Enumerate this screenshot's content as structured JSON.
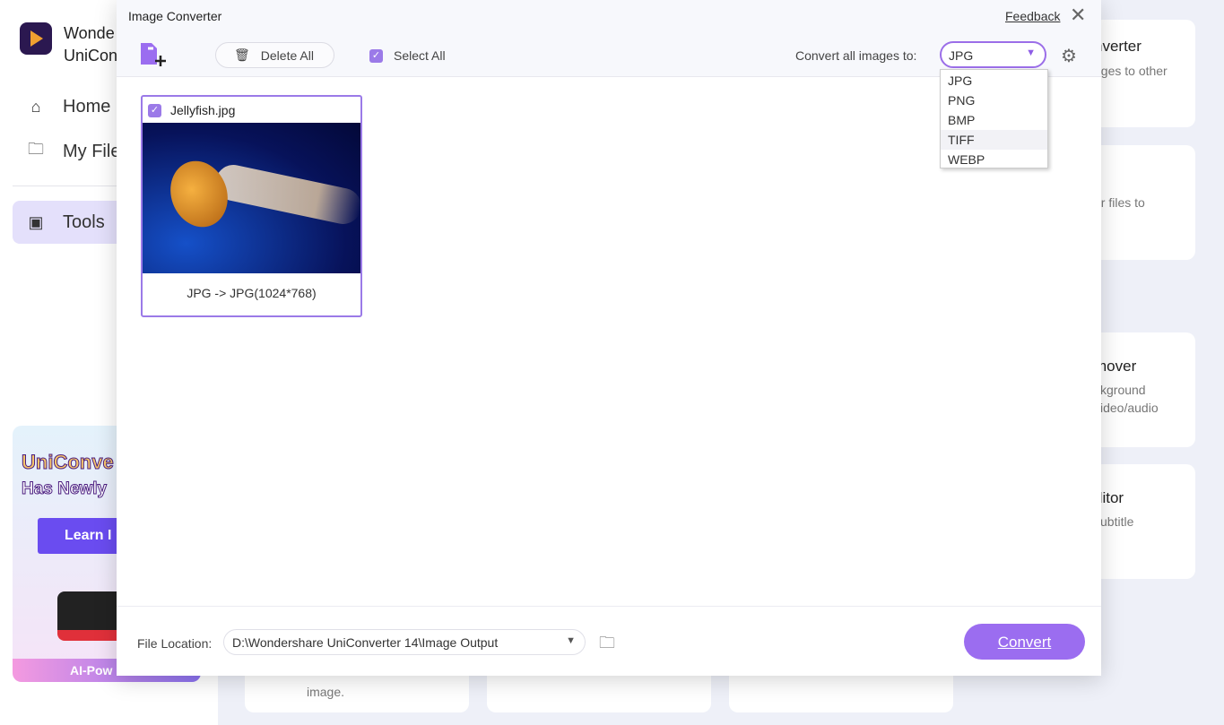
{
  "app": {
    "name_line1": "Wonde",
    "name_line2": "UniCon"
  },
  "sidebar": {
    "items": [
      {
        "label": "Home",
        "icon": "home-icon"
      },
      {
        "label": "My File",
        "icon": "folder-icon"
      },
      {
        "label": "Tools",
        "icon": "toolbox-icon",
        "active": true
      }
    ]
  },
  "banner": {
    "line1": "UniConve",
    "line2": "Has Newly",
    "button": "Learn I",
    "footer": "AI-Pow"
  },
  "background_cards": [
    {
      "title": "nverter",
      "desc": "ages to other"
    },
    {
      "title": "",
      "desc": "ur files to"
    },
    {
      "title": "mover",
      "desc": "ckground\nvideo/audio"
    },
    {
      "title": "ditor",
      "desc": "subtitle\n."
    },
    {
      "desc": "image."
    }
  ],
  "modal": {
    "title": "Image Converter",
    "feedback": "Feedback",
    "delete_all": "Delete All",
    "select_all": "Select All",
    "convert_label": "Convert all images to:",
    "format_selected": "JPG",
    "format_options": [
      "JPG",
      "PNG",
      "BMP",
      "TIFF",
      "WEBP"
    ],
    "files": [
      {
        "name": "Jellyfish.jpg",
        "info": "JPG -> JPG(1024*768)",
        "checked": true
      }
    ],
    "file_location_label": "File Location:",
    "file_location": "D:\\Wondershare UniConverter 14\\Image Output",
    "convert_button": "Convert"
  },
  "colors": {
    "accent": "#9b6df0",
    "banner_button": "#6a4cf0"
  }
}
